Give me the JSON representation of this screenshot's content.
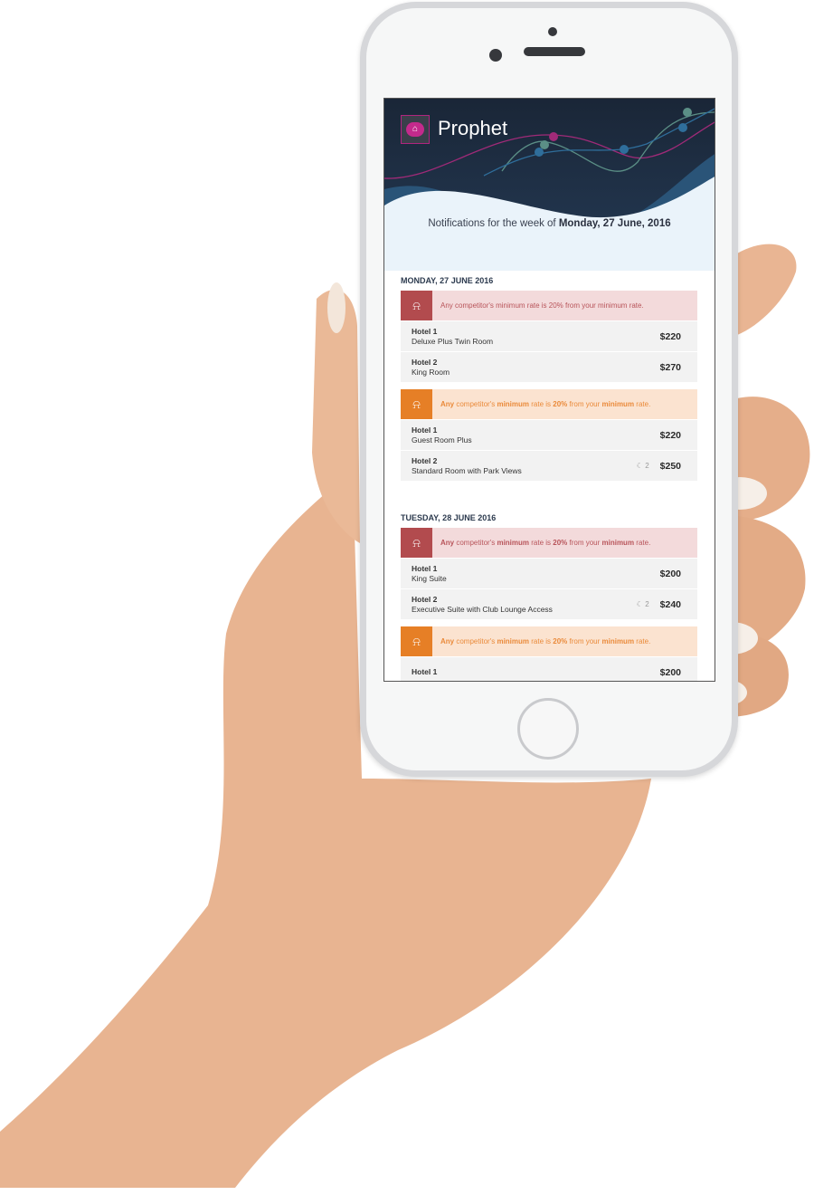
{
  "app": {
    "title": "Prophet",
    "logo_icon": "home-cloud-icon"
  },
  "subtitle": {
    "prefix": "Notifications for the week of ",
    "date": "Monday, 27 June, 2016"
  },
  "colors": {
    "alert_red": "#b24b4e",
    "alert_orange": "#e67f26",
    "header": "#1a2637"
  },
  "sections": [
    {
      "date": "MONDAY, 27 JUNE 2016",
      "alerts": [
        {
          "level": "red",
          "segments": [
            {
              "t": "Any competitor's minimum rate is 20% from your minimum rate.",
              "b": false
            }
          ],
          "rows": [
            {
              "hotel": "Hotel 1",
              "room": "Deluxe Plus Twin Room",
              "price": "$220"
            },
            {
              "hotel": "Hotel 2",
              "room": "King Room",
              "price": "$270"
            }
          ]
        },
        {
          "level": "orange",
          "segments": [
            {
              "t": "Any",
              "b": true
            },
            {
              "t": " competitor's ",
              "b": false
            },
            {
              "t": "minimum",
              "b": true
            },
            {
              "t": " rate is ",
              "b": false
            },
            {
              "t": "20%",
              "b": true
            },
            {
              "t": " from your ",
              "b": false
            },
            {
              "t": "minimum",
              "b": true
            },
            {
              "t": " rate.",
              "b": false
            }
          ],
          "rows": [
            {
              "hotel": "Hotel 1",
              "room": "Guest Room Plus",
              "price": "$220"
            },
            {
              "hotel": "Hotel 2",
              "room": "Standard Room with Park Views",
              "price": "$250",
              "nights": "2"
            }
          ]
        }
      ]
    },
    {
      "date": "TUESDAY, 28 JUNE 2016",
      "alerts": [
        {
          "level": "red",
          "segments": [
            {
              "t": "Any",
              "b": true
            },
            {
              "t": " competitor's ",
              "b": false
            },
            {
              "t": "minimum",
              "b": true
            },
            {
              "t": " rate is ",
              "b": false
            },
            {
              "t": "20%",
              "b": true
            },
            {
              "t": " from your ",
              "b": false
            },
            {
              "t": "minimum",
              "b": true
            },
            {
              "t": " rate.",
              "b": false
            }
          ],
          "rows": [
            {
              "hotel": "Hotel 1",
              "room": "King Suite",
              "price": "$200"
            },
            {
              "hotel": "Hotel 2",
              "room": "Executive Suite with Club Lounge Access",
              "price": "$240",
              "nights": "2"
            }
          ]
        },
        {
          "level": "orange",
          "segments": [
            {
              "t": "Any",
              "b": true
            },
            {
              "t": " competitor's ",
              "b": false
            },
            {
              "t": "minimum",
              "b": true
            },
            {
              "t": " rate is ",
              "b": false
            },
            {
              "t": "20%",
              "b": true
            },
            {
              "t": " from your ",
              "b": false
            },
            {
              "t": "minimum",
              "b": true
            },
            {
              "t": " rate.",
              "b": false
            }
          ],
          "rows": [
            {
              "hotel": "Hotel 1",
              "room": "",
              "price": "$200"
            }
          ]
        }
      ]
    }
  ]
}
